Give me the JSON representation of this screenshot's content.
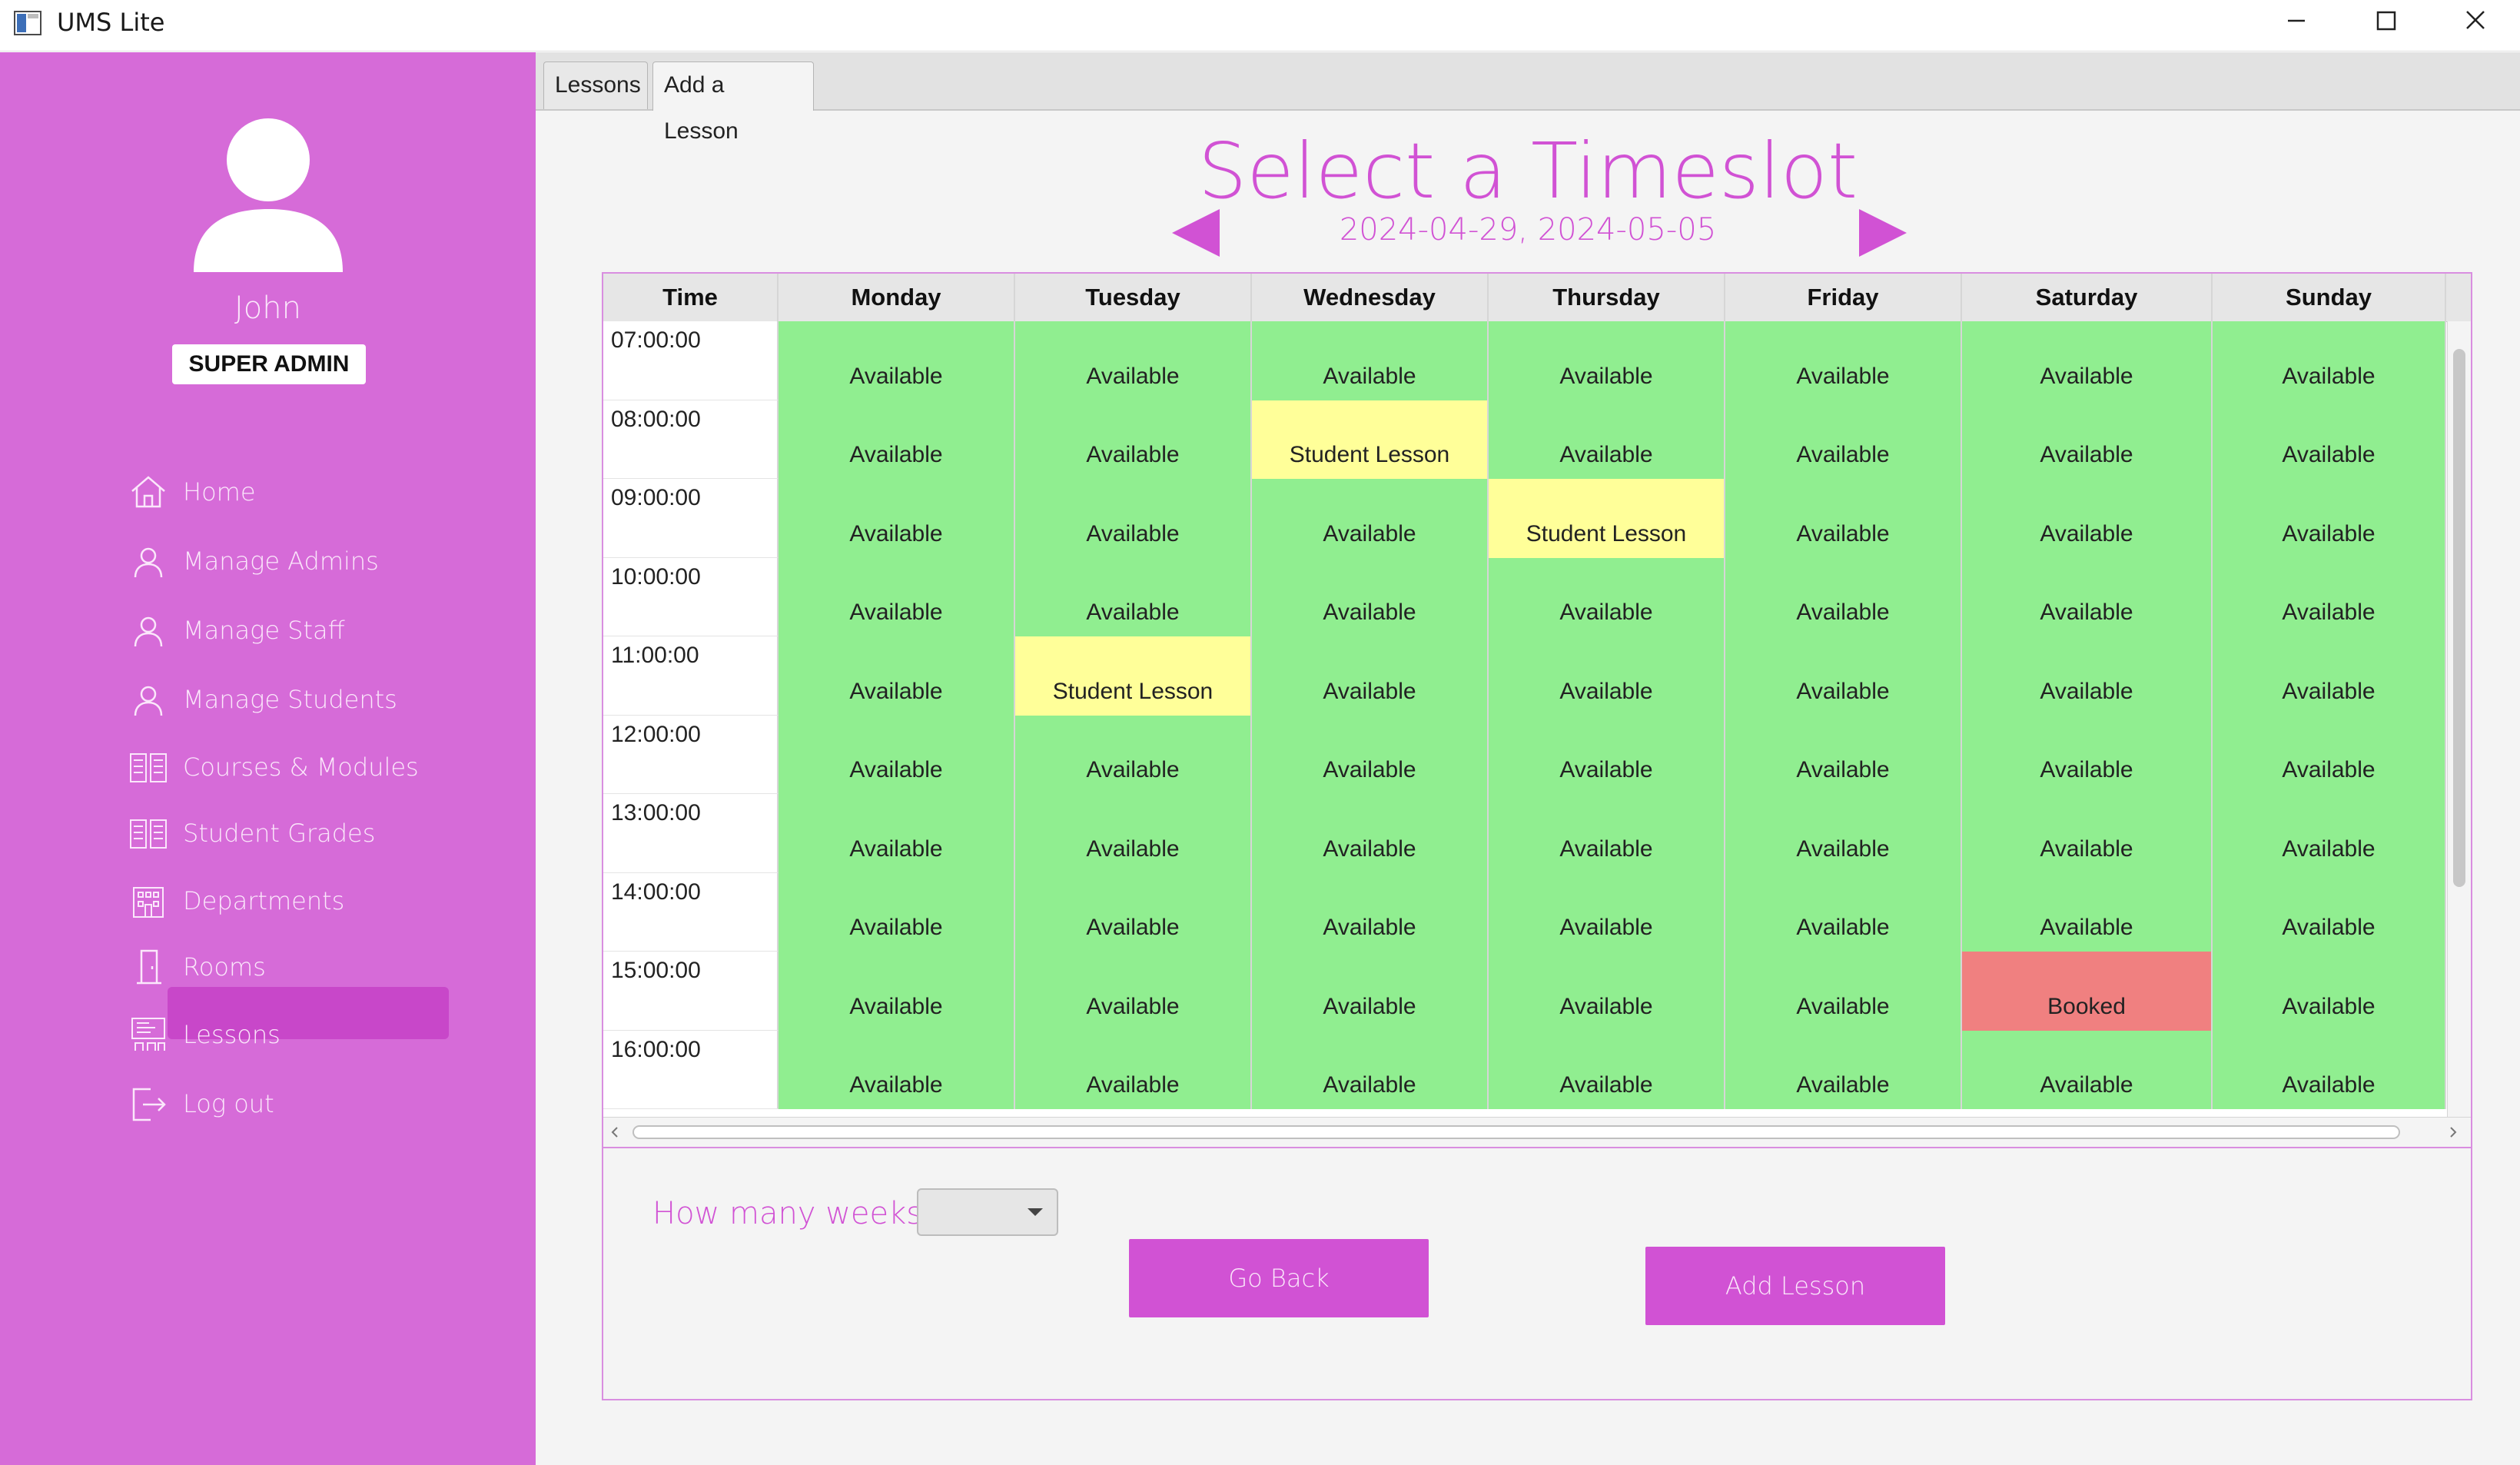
{
  "window": {
    "title": "UMS Lite",
    "minimize_icon": "minimize-icon",
    "maximize_icon": "maximize-icon",
    "close_icon": "close-icon"
  },
  "sidebar": {
    "user_name": "John",
    "role": "SUPER ADMIN",
    "items": [
      {
        "label": "Home",
        "icon": "home-icon"
      },
      {
        "label": "Manage Admins",
        "icon": "user-icon"
      },
      {
        "label": "Manage Staff",
        "icon": "user-icon"
      },
      {
        "label": "Manage Students",
        "icon": "user-icon"
      },
      {
        "label": "Courses & Modules",
        "icon": "books-icon"
      },
      {
        "label": "Student Grades",
        "icon": "books-icon"
      },
      {
        "label": "Departments",
        "icon": "building-icon"
      },
      {
        "label": "Rooms",
        "icon": "door-icon"
      },
      {
        "label": "Lessons",
        "icon": "lessons-icon",
        "active": true
      },
      {
        "label": "Log out",
        "icon": "logout-icon"
      }
    ]
  },
  "tabs": [
    {
      "label": "Lessons",
      "selected": false
    },
    {
      "label": "Add a Lesson",
      "selected": true
    }
  ],
  "page": {
    "title": "Select a Timeslot",
    "week_range": "2024-04-29, 2024-05-05"
  },
  "timetable": {
    "columns": [
      "Time",
      "Monday",
      "Tuesday",
      "Wednesday",
      "Thursday",
      "Friday",
      "Saturday",
      "Sunday"
    ],
    "rows": [
      {
        "time": "07:00:00",
        "slots": [
          "Available",
          "Available",
          "Available",
          "Available",
          "Available",
          "Available",
          "Available"
        ]
      },
      {
        "time": "08:00:00",
        "slots": [
          "Available",
          "Available",
          "Student Lesson",
          "Available",
          "Available",
          "Available",
          "Available"
        ]
      },
      {
        "time": "09:00:00",
        "slots": [
          "Available",
          "Available",
          "Available",
          "Student Lesson",
          "Available",
          "Available",
          "Available"
        ]
      },
      {
        "time": "10:00:00",
        "slots": [
          "Available",
          "Available",
          "Available",
          "Available",
          "Available",
          "Available",
          "Available"
        ]
      },
      {
        "time": "11:00:00",
        "slots": [
          "Available",
          "Student Lesson",
          "Available",
          "Available",
          "Available",
          "Available",
          "Available"
        ]
      },
      {
        "time": "12:00:00",
        "slots": [
          "Available",
          "Available",
          "Available",
          "Available",
          "Available",
          "Available",
          "Available"
        ]
      },
      {
        "time": "13:00:00",
        "slots": [
          "Available",
          "Available",
          "Available",
          "Available",
          "Available",
          "Available",
          "Available"
        ]
      },
      {
        "time": "14:00:00",
        "slots": [
          "Available",
          "Available",
          "Available",
          "Available",
          "Available",
          "Available",
          "Available"
        ]
      },
      {
        "time": "15:00:00",
        "slots": [
          "Available",
          "Available",
          "Available",
          "Available",
          "Available",
          "Booked",
          "Available"
        ]
      },
      {
        "time": "16:00:00",
        "slots": [
          "Available",
          "Available",
          "Available",
          "Available",
          "Available",
          "Available",
          "Available"
        ]
      }
    ],
    "status_colors": {
      "Available": "#90ee90",
      "Student Lesson": "#ffff99",
      "Booked": "#f08080"
    }
  },
  "form": {
    "weeks_label": "How many weeks",
    "weeks_value": "",
    "go_back_label": "Go Back",
    "add_lesson_label": "Add Lesson"
  },
  "colors": {
    "sidebar": "#d66bd8",
    "accent": "#d152d4",
    "active_nav": "#c847c9"
  }
}
